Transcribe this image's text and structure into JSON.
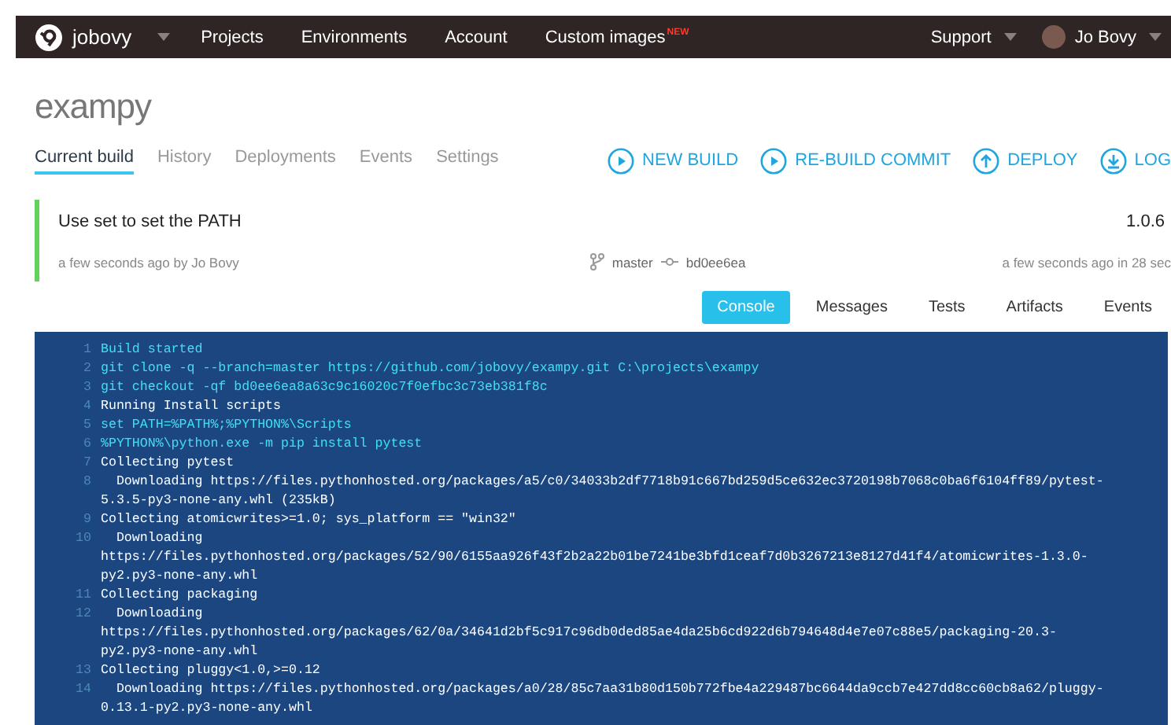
{
  "navbar": {
    "brand": "jobovy",
    "links": [
      {
        "label": "Projects"
      },
      {
        "label": "Environments"
      },
      {
        "label": "Account"
      },
      {
        "label": "Custom images",
        "badge": "NEW"
      }
    ],
    "support": "Support",
    "user": "Jo Bovy"
  },
  "project": {
    "title": "exampy"
  },
  "tabs": [
    {
      "label": "Current build",
      "selected": true
    },
    {
      "label": "History",
      "selected": false
    },
    {
      "label": "Deployments",
      "selected": false
    },
    {
      "label": "Events",
      "selected": false
    },
    {
      "label": "Settings",
      "selected": false
    }
  ],
  "actions": [
    {
      "label": "NEW BUILD",
      "kind": "play"
    },
    {
      "label": "RE-BUILD COMMIT",
      "kind": "play"
    },
    {
      "label": "DEPLOY",
      "kind": "up"
    },
    {
      "label": "LOG",
      "kind": "down"
    }
  ],
  "build": {
    "passed": true,
    "message": "Use set to set the PATH",
    "version": "1.0.6",
    "author_line": "a few seconds ago by Jo Bovy",
    "branch": "master",
    "commit": "bd0ee6ea",
    "duration_line": "a few seconds ago in 28 sec"
  },
  "console_tabs": [
    {
      "label": "Console",
      "selected": true
    },
    {
      "label": "Messages",
      "selected": false
    },
    {
      "label": "Tests",
      "selected": false
    },
    {
      "label": "Artifacts",
      "selected": false
    },
    {
      "label": "Events",
      "selected": false
    }
  ],
  "console_lines": [
    {
      "number": "1",
      "kind": "command",
      "rows": [
        "Build started"
      ]
    },
    {
      "number": "2",
      "kind": "command",
      "rows": [
        "git clone -q --branch=master https://github.com/jobovy/exampy.git C:\\projects\\exampy"
      ]
    },
    {
      "number": "3",
      "kind": "command",
      "rows": [
        "git checkout -qf bd0ee6ea8a63c9c16020c7f0efbc3c73eb381f8c"
      ]
    },
    {
      "number": "4",
      "kind": "output",
      "rows": [
        "Running Install scripts"
      ]
    },
    {
      "number": "5",
      "kind": "command",
      "rows": [
        "set PATH=%PATH%;%PYTHON%\\Scripts"
      ]
    },
    {
      "number": "6",
      "kind": "command",
      "rows": [
        "%PYTHON%\\python.exe -m pip install pytest"
      ]
    },
    {
      "number": "7",
      "kind": "output",
      "rows": [
        "Collecting pytest"
      ]
    },
    {
      "number": "8",
      "kind": "output",
      "rows": [
        "  Downloading https://files.pythonhosted.org/packages/a5/c0/34033b2df7718b91c667bd259d5ce632ec3720198b7068c0ba6f6104ff89/pytest-",
        "5.3.5-py3-none-any.whl (235kB)"
      ]
    },
    {
      "number": "9",
      "kind": "output",
      "rows": [
        "Collecting atomicwrites>=1.0; sys_platform == \"win32\""
      ]
    },
    {
      "number": "10",
      "kind": "output",
      "rows": [
        "  Downloading",
        "https://files.pythonhosted.org/packages/52/90/6155aa926f43f2b2a22b01be7241be3bfd1ceaf7d0b3267213e8127d41f4/atomicwrites-1.3.0-",
        "py2.py3-none-any.whl"
      ]
    },
    {
      "number": "11",
      "kind": "output",
      "rows": [
        "Collecting packaging"
      ]
    },
    {
      "number": "12",
      "kind": "output",
      "rows": [
        "  Downloading",
        "https://files.pythonhosted.org/packages/62/0a/34641d2bf5c917c96db0ded85ae4da25b6cd922d6b794648d4e7e07c88e5/packaging-20.3-",
        "py2.py3-none-any.whl"
      ]
    },
    {
      "number": "13",
      "kind": "output",
      "rows": [
        "Collecting pluggy<1.0,>=0.12"
      ]
    },
    {
      "number": "14",
      "kind": "output",
      "rows": [
        "  Downloading https://files.pythonhosted.org/packages/a0/28/85c7aa31b80d150b772fbe4a229487bc6644da9ccb7e427dd8cc60cb8a62/pluggy-",
        "0.13.1-py2.py3-none-any.whl"
      ]
    }
  ]
}
